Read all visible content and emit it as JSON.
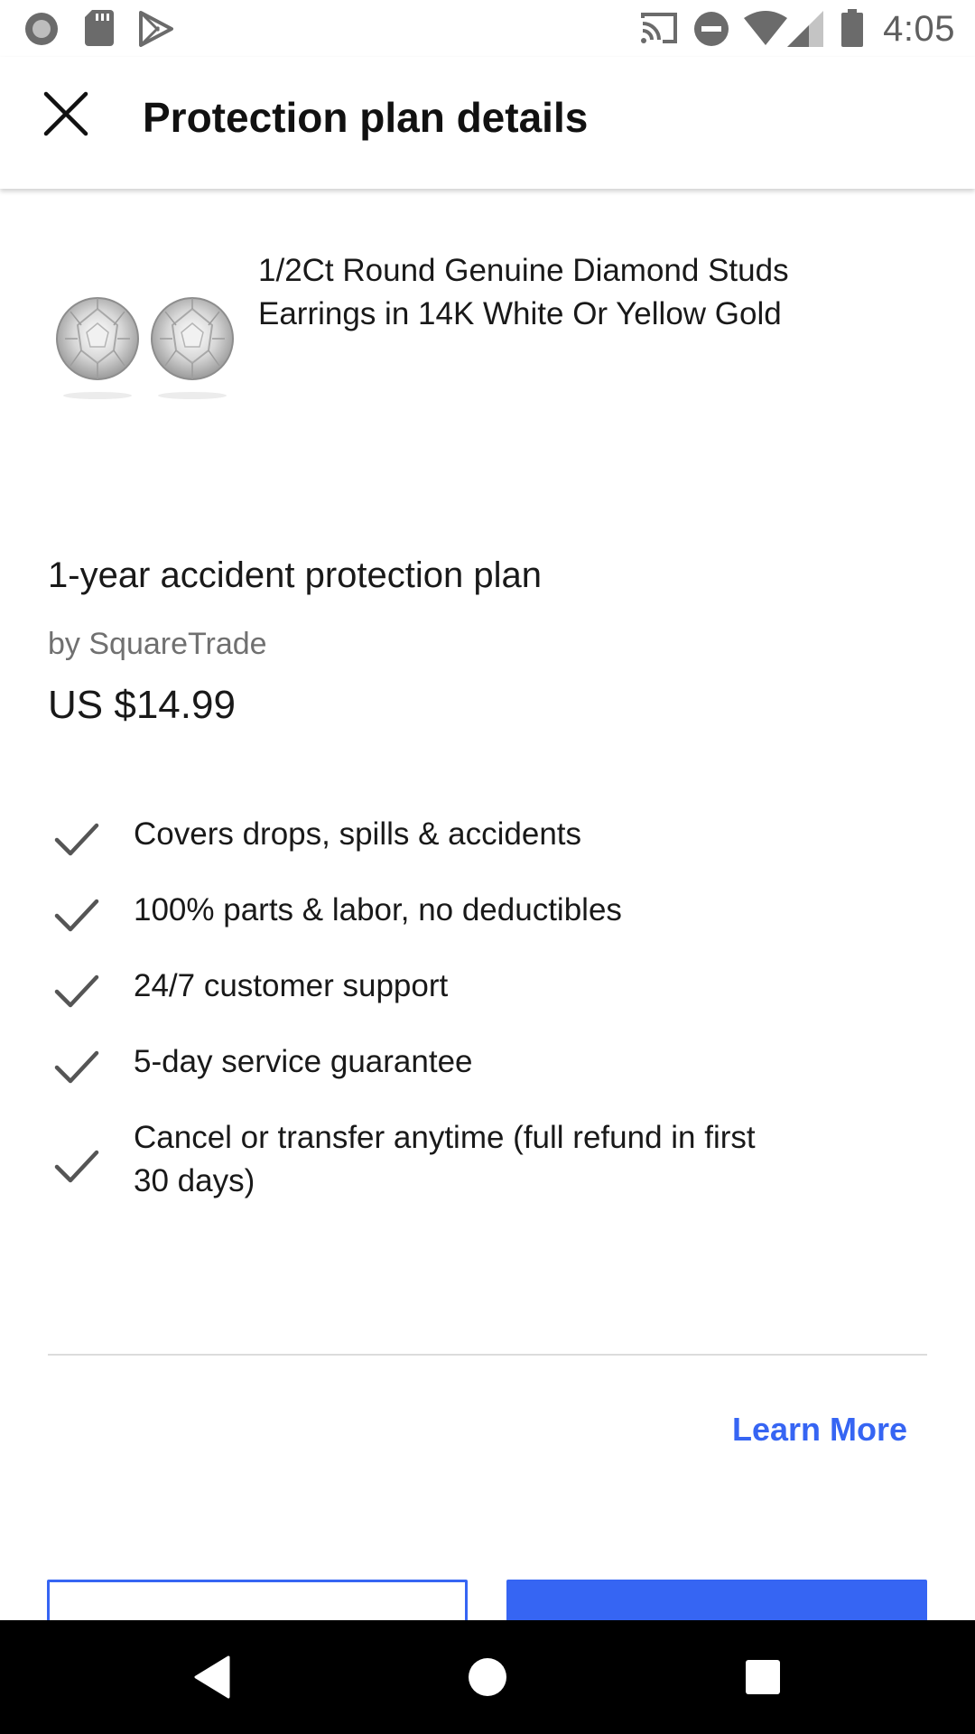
{
  "status_bar": {
    "time": "4:05",
    "left_icons": [
      "notification-dot-icon",
      "sd-card-icon",
      "play-store-icon"
    ],
    "right_icons": [
      "cast-icon",
      "do-not-disturb-icon",
      "wifi-icon",
      "cell-signal-icon",
      "battery-icon"
    ]
  },
  "app_bar": {
    "title": "Protection plan details",
    "close_icon": "close-icon"
  },
  "product": {
    "title": "1/2Ct Round Genuine Diamond Studs Earrings in 14K White Or Yellow Gold",
    "image": "diamond-stud-earrings"
  },
  "plan": {
    "name": "1-year accident protection plan",
    "provider": "by SquareTrade",
    "price": "US $14.99"
  },
  "features": [
    "Covers drops, spills & accidents",
    "100% parts & labor, no deductibles",
    "24/7 customer support",
    "5-day service guarantee",
    "Cancel or transfer anytime (full refund in first 30 days)"
  ],
  "learn_more_label": "Learn More",
  "colors": {
    "accent": "#3665f3",
    "text": "#191919",
    "secondary_text": "#707070",
    "check": "#555555"
  },
  "nav_bar": {
    "icons": [
      "back-icon",
      "home-icon",
      "recents-icon"
    ]
  }
}
